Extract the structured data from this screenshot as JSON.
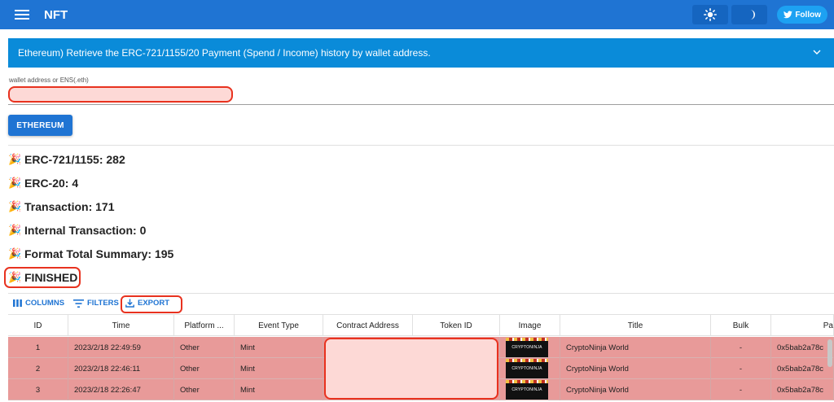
{
  "appbar": {
    "title": "NFT",
    "follow_label": "Follow",
    "light_icon": "sun-icon",
    "dark_icon": "moon-icon"
  },
  "banner": {
    "text": "Ethereum) Retrieve the ERC-721/1155/20 Payment (Spend / Income) history by wallet address."
  },
  "input": {
    "label": "wallet address or ENS(.eth)",
    "value": ""
  },
  "network_button": "ETHEREUM",
  "stats": [
    {
      "label": "ERC-721/1155: 282"
    },
    {
      "label": "ERC-20: 4"
    },
    {
      "label": "Transaction: 171"
    },
    {
      "label": "Internal Transaction: 0"
    },
    {
      "label": "Format Total Summary: 195"
    },
    {
      "label": "FINISHED"
    }
  ],
  "toolbar": {
    "columns": "COLUMNS",
    "filters": "FILTERS",
    "export": "EXPORT"
  },
  "table": {
    "headers": [
      "ID",
      "Time",
      "Platform ...",
      "Event Type",
      "Contract Address",
      "Token ID",
      "Image",
      "Title",
      "Bulk",
      "Pa"
    ],
    "rows": [
      {
        "id": "1",
        "time": "2023/2/18 22:49:59",
        "platform": "Other",
        "event": "Mint",
        "title": "CryptoNinja World",
        "bulk": "-",
        "pay": "0x5bab2a78c"
      },
      {
        "id": "2",
        "time": "2023/2/18 22:46:11",
        "platform": "Other",
        "event": "Mint",
        "title": "CryptoNinja World",
        "bulk": "-",
        "pay": "0x5bab2a78c"
      },
      {
        "id": "3",
        "time": "2023/2/18 22:26:47",
        "platform": "Other",
        "event": "Mint",
        "title": "CryptoNinja World",
        "bulk": "-",
        "pay": "0x5bab2a78c"
      }
    ],
    "image_caption": "CRYPTONINJA"
  },
  "colors": {
    "appbar": "#1f74d3",
    "banner": "#0a8bd9",
    "highlight_border": "#e8321f",
    "row_bg": "#e89a99"
  }
}
